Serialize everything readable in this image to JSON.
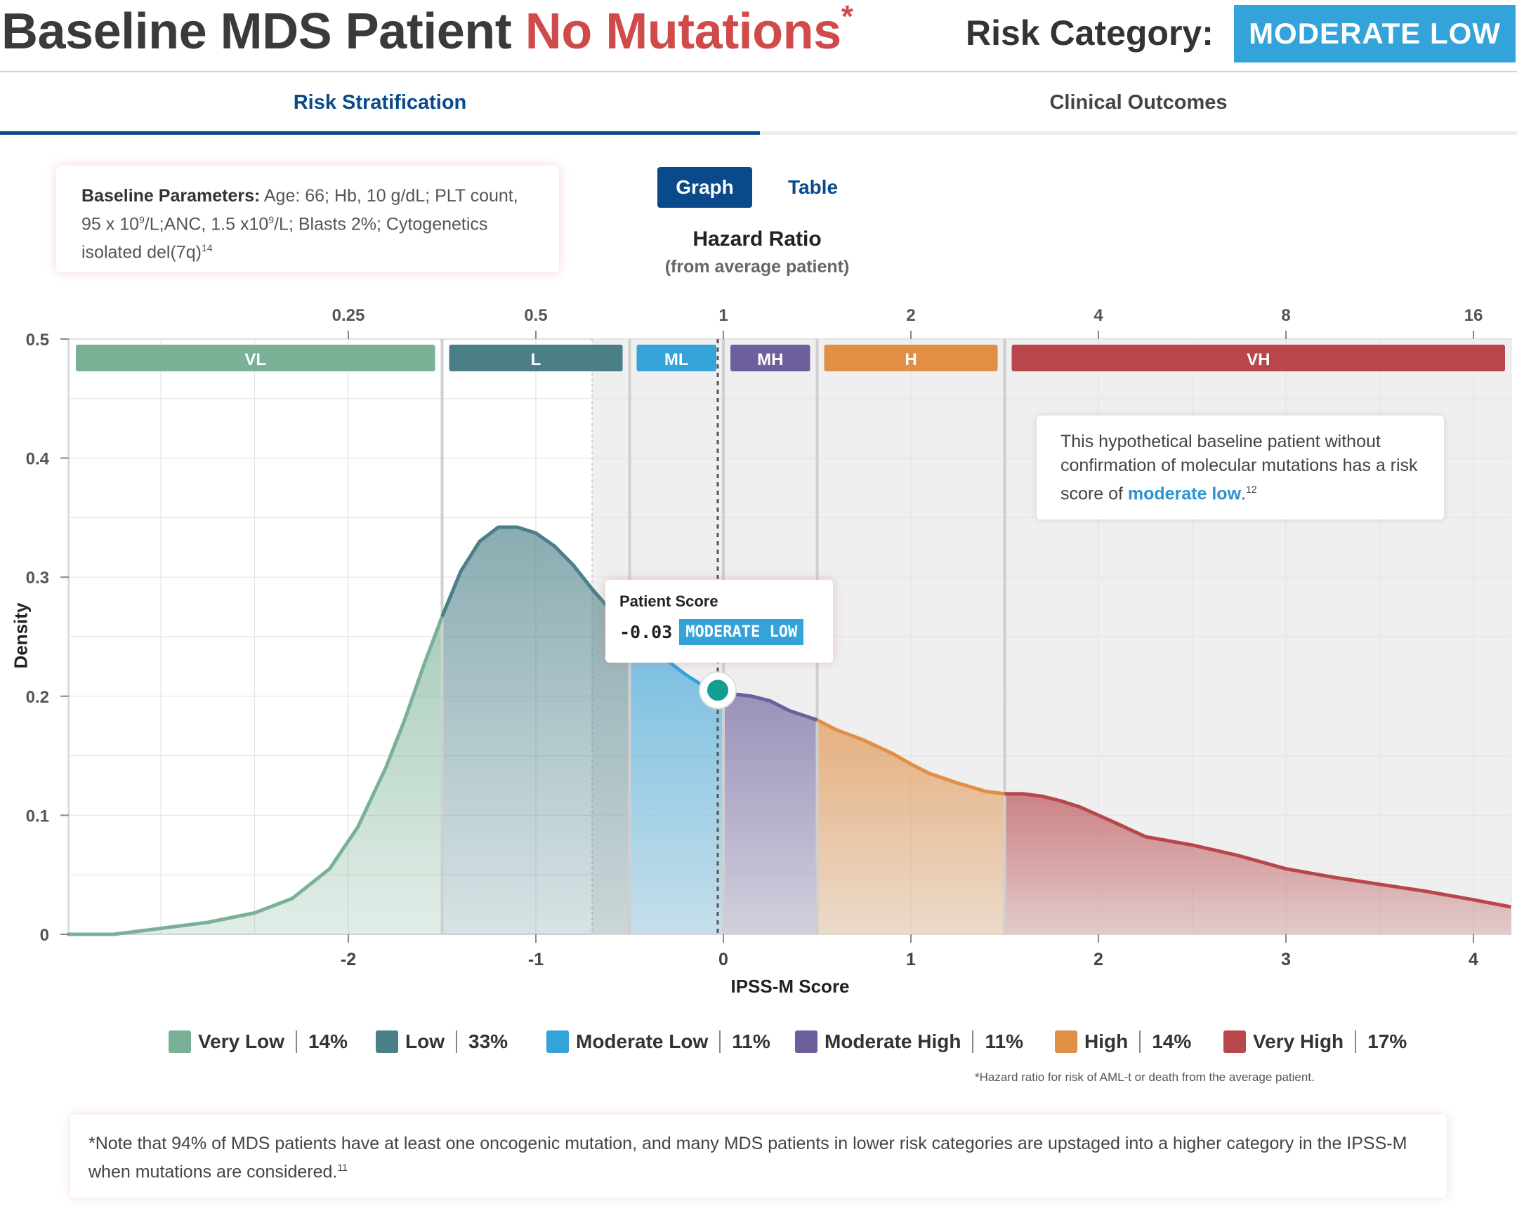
{
  "header": {
    "title_main": "Baseline MDS Patient",
    "title_highlight": "No Mutations",
    "title_asterisk": "*",
    "risk_label": "Risk Category:",
    "risk_value": "MODERATE LOW"
  },
  "tabs": [
    {
      "label": "Risk Stratification",
      "active": true
    },
    {
      "label": "Clinical Outcomes",
      "active": false
    }
  ],
  "baseline": {
    "label": "Baseline Parameters:",
    "text_1": " Age: 66; Hb, 10 g/dL; PLT count, 95 x 10",
    "sup_1": "9",
    "text_2": "/L;ANC, 1.5 x10",
    "sup_2": "9",
    "text_3": "/L; Blasts 2%; Cytogenetics isolated del(7q)",
    "ref": "14"
  },
  "view_toggle": {
    "graph": "Graph",
    "table": "Table",
    "active": "graph"
  },
  "hazard": {
    "title": "Hazard Ratio",
    "subtitle": "(from average patient)"
  },
  "annotation": {
    "text": "This hypothetical baseline patient without confirmation of molecular mutations has a risk score of ",
    "emphasis": "moderate low",
    "suffix": ".",
    "ref": "12"
  },
  "patient_score": {
    "title": "Patient Score",
    "value": "-0.03",
    "category": "MODERATE LOW"
  },
  "legend": [
    {
      "label": "Very Low",
      "pct": "14%",
      "color": "#7ab196"
    },
    {
      "label": "Low",
      "pct": "33%",
      "color": "#4b7f88"
    },
    {
      "label": "Moderate Low",
      "pct": "11%",
      "color": "#34a3d9"
    },
    {
      "label": "Moderate High",
      "pct": "11%",
      "color": "#6d5f9c"
    },
    {
      "label": "High",
      "pct": "14%",
      "color": "#e08f45"
    },
    {
      "label": "Very High",
      "pct": "17%",
      "color": "#b8474b"
    }
  ],
  "footnote_small": "*Hazard ratio for risk of AML-t or death from the average patient.",
  "note": {
    "text": "*Note that 94% of MDS patients have at least one oncogenic mutation, and many MDS patients in lower risk categories are upstaged into a higher category in the IPSS-M when mutations are considered.",
    "ref": "11"
  },
  "chart_data": {
    "type": "area",
    "xlabel": "IPSS-M Score",
    "ylabel": "Density",
    "top_axis_title": "Hazard Ratio",
    "xlim": [
      -3.5,
      4.2
    ],
    "ylim": [
      0,
      0.5
    ],
    "x_ticks": [
      -2,
      -1,
      0,
      1,
      2,
      3,
      4
    ],
    "y_ticks": [
      0,
      0.1,
      0.2,
      0.3,
      0.4,
      0.5
    ],
    "y_tick_labels": [
      "0",
      "0.1",
      "0.2",
      "0.3",
      "0.4",
      "0.5"
    ],
    "top_ticks": [
      {
        "label": "0.25",
        "x": -2
      },
      {
        "label": "0.5",
        "x": -1
      },
      {
        "label": "1",
        "x": 0
      },
      {
        "label": "2",
        "x": 1
      },
      {
        "label": "4",
        "x": 2
      },
      {
        "label": "8",
        "x": 3
      },
      {
        "label": "16",
        "x": 4
      }
    ],
    "categories": [
      {
        "abbr": "VL",
        "name": "Very Low",
        "from": -3.5,
        "to": -1.5,
        "color": "#7ab196"
      },
      {
        "abbr": "L",
        "name": "Low",
        "from": -1.5,
        "to": -0.5,
        "color": "#4b7f88"
      },
      {
        "abbr": "ML",
        "name": "Moderate Low",
        "from": -0.5,
        "to": 0,
        "color": "#34a3d9"
      },
      {
        "abbr": "MH",
        "name": "Moderate High",
        "from": 0,
        "to": 0.5,
        "color": "#6d5f9c"
      },
      {
        "abbr": "H",
        "name": "High",
        "from": 0.5,
        "to": 1.5,
        "color": "#e08f45"
      },
      {
        "abbr": "VH",
        "name": "Very High",
        "from": 1.5,
        "to": 4.2,
        "color": "#b8474b"
      }
    ],
    "x": [
      -3.5,
      -3.25,
      -3.0,
      -2.75,
      -2.5,
      -2.3,
      -2.1,
      -1.95,
      -1.8,
      -1.7,
      -1.6,
      -1.5,
      -1.4,
      -1.3,
      -1.2,
      -1.1,
      -1.0,
      -0.9,
      -0.8,
      -0.7,
      -0.6,
      -0.5,
      -0.4,
      -0.3,
      -0.2,
      -0.1,
      -0.03,
      0.05,
      0.15,
      0.25,
      0.35,
      0.5,
      0.6,
      0.75,
      0.9,
      1.0,
      1.1,
      1.25,
      1.4,
      1.5,
      1.6,
      1.7,
      1.8,
      1.9,
      2.0,
      2.1,
      2.25,
      2.5,
      2.75,
      3.0,
      3.25,
      3.5,
      3.75,
      4.0,
      4.2
    ],
    "values": [
      0.0,
      0.0,
      0.005,
      0.01,
      0.018,
      0.03,
      0.055,
      0.09,
      0.14,
      0.18,
      0.225,
      0.267,
      0.305,
      0.33,
      0.342,
      0.342,
      0.337,
      0.326,
      0.31,
      0.29,
      0.272,
      0.254,
      0.243,
      0.23,
      0.218,
      0.208,
      0.203,
      0.202,
      0.2,
      0.196,
      0.188,
      0.18,
      0.172,
      0.163,
      0.152,
      0.143,
      0.135,
      0.127,
      0.12,
      0.118,
      0.118,
      0.116,
      0.112,
      0.107,
      0.1,
      0.093,
      0.082,
      0.075,
      0.066,
      0.055,
      0.048,
      0.042,
      0.036,
      0.029,
      0.023
    ],
    "patient_score": -0.03,
    "patient_density": 0.205
  }
}
